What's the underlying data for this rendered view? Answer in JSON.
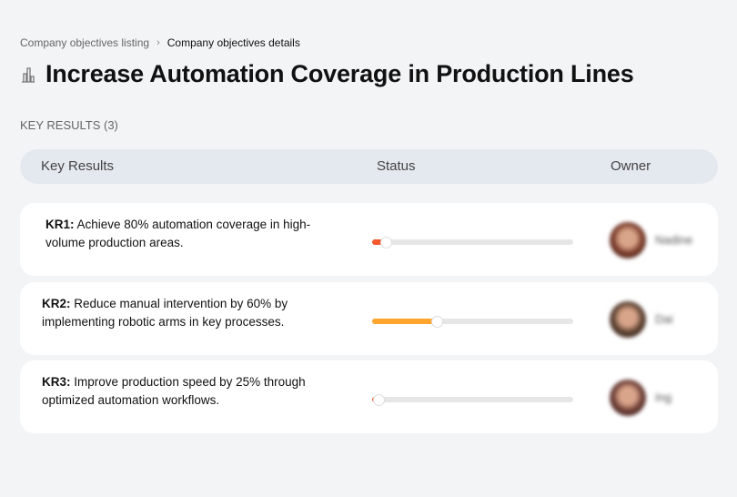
{
  "breadcrumb": {
    "items": [
      "Company objectives listing",
      "Company objectives details"
    ],
    "separator": "›"
  },
  "title": {
    "icon": "building-chart-icon",
    "text": "Increase Automation Coverage in Production Lines"
  },
  "section": {
    "label": "KEY RESULTS (3)"
  },
  "table": {
    "headers": {
      "key_results": "Key Results",
      "status": "Status",
      "owner": "Owner"
    },
    "rows": [
      {
        "id": "KR1:",
        "text": " Achieve 80% automation coverage in high-volume production areas.",
        "progress_percent": 7,
        "progress_color": "#f4572c",
        "owner": "Nadine",
        "avatar_color": "#7a3a2a"
      },
      {
        "id": "KR2:",
        "text": " Reduce manual intervention by 60% by implementing robotic arms in key processes.",
        "progress_percent": 32,
        "progress_color": "#ffa52e",
        "owner": "Dai",
        "avatar_color": "#5a4030"
      },
      {
        "id": "KR3:",
        "text": " Improve production speed by 25% through optimized automation workflows.",
        "progress_percent": 3,
        "progress_color": "#f4572c",
        "owner": "Ing",
        "avatar_color": "#6b3b35"
      }
    ]
  }
}
